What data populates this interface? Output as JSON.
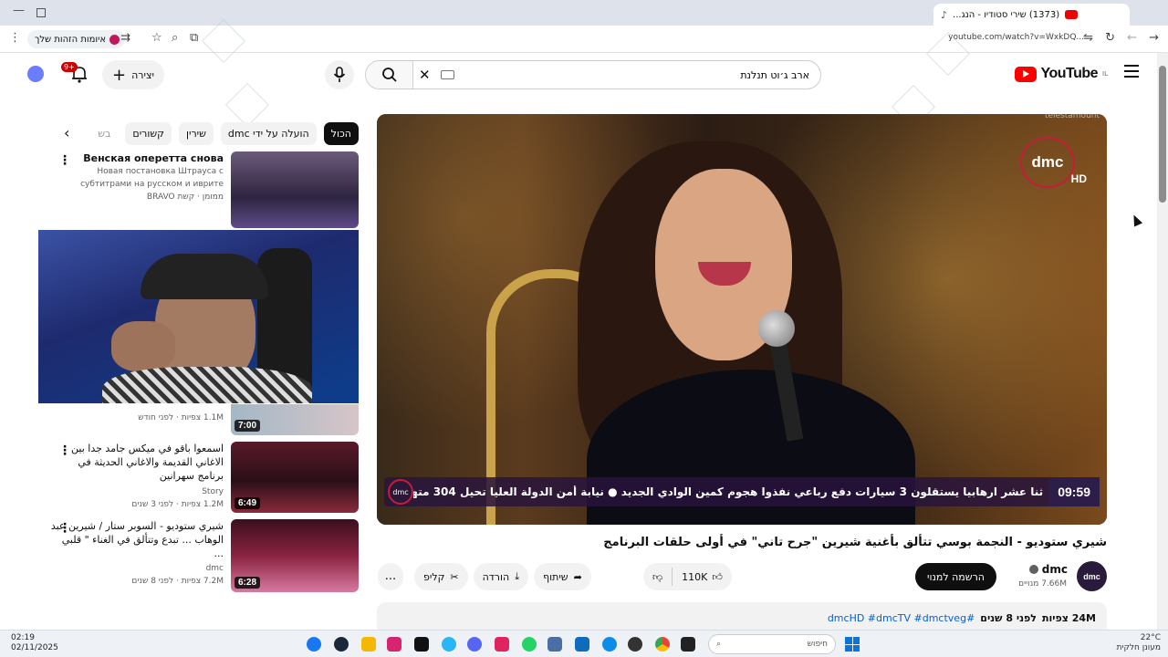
{
  "browser": {
    "tab_title": "(1373) שירי סטודיו - הנג...",
    "url": "youtube.com/watch?v=WxkDQ..."
  },
  "toolbar": {
    "security_label": "איומות הזהות שלך"
  },
  "header": {
    "logo_text": "YouTube",
    "logo_region": "IL",
    "search_value": "ארב ג׳וט תנלנת",
    "create_label": "יצירה",
    "notif_count": "9+"
  },
  "player": {
    "channel_logo": "dmc",
    "channel_hd": "HD",
    "watermark": "telestamount",
    "ticker_text": "ثنا عشر ارهابيا يستقلون 3 سيارات دفع رباعي  نفذوا هجوم كمين الوادي الجديد  ●  نيابة أمن الدولة العليا تحيل 304 متهم",
    "ticker_time": "09:59"
  },
  "video": {
    "title": "شيري ستوديو - النجمة بوسي تتألق بأغنية شيرين \"جرح تاني\" في أولى حلقات البرنامج",
    "channel": "dmc",
    "subscribers": "7.66M מנויים",
    "subscribe_label": "הרשמה למנוי",
    "likes": "110K",
    "share_label": "שיתוף",
    "download_label": "הורדה",
    "clip_label": "קליפ",
    "more_label": "...",
    "views": "24M צפיות",
    "age": "לפני 8 שנים",
    "tags": "#dmcHD #dmcTV #dmctveg"
  },
  "chips": [
    "הכול",
    "הועלה על ידי dmc",
    "שירין",
    "קשורים",
    "בש"
  ],
  "recommendations": [
    {
      "title": "Венская оперетта снова",
      "subtitle": "Новая постановка Штрауса с субтитрами на русском и иврите",
      "channel": "ממומן · קשת BRAVO"
    },
    {
      "views": "1.1M צפיות · לפני חודש",
      "duration": "7:00"
    },
    {
      "title": "اسمعوا باقو في ميكس جامد جدا بين الاغاني القديمة والاغاني الحديثة في برنامج سهرانين",
      "channel": "Story",
      "views": "1.2M צפיות · לפני 3 שנים",
      "duration": "6:49"
    },
    {
      "title": "شيري ستوديو - السوبر ستار / شيرين عبد الوهاب ... تبدع وتتألق في الغناء \" قلبي ...",
      "channel": "dmc",
      "views": "7.2M צפיות · לפני 8 שנים",
      "duration": "6:28"
    }
  ],
  "taskbar": {
    "time": "02:19",
    "date": "02/11/2025",
    "search_placeholder": "חיפוש",
    "weather_temp": "22°C",
    "weather_desc": "מעונן חלקית"
  },
  "colors": {
    "accent_red": "#ff0000",
    "dmc_red": "#c61c3c",
    "link_blue": "#065fd4"
  }
}
